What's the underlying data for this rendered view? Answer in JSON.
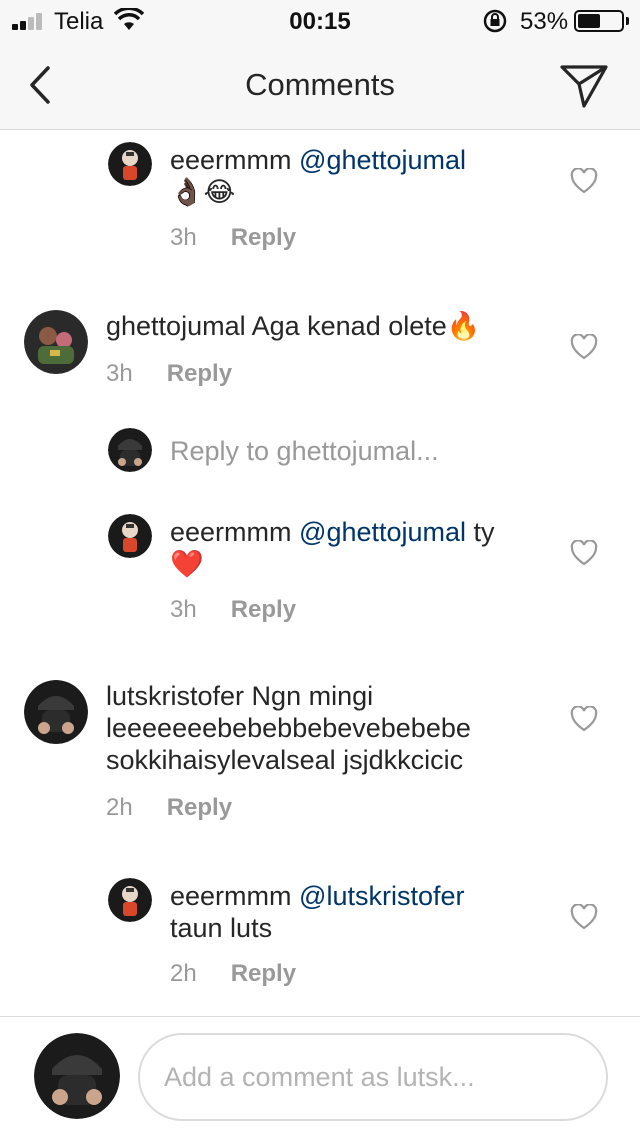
{
  "status_bar": {
    "carrier": "Telia",
    "time": "00:15",
    "battery_percent": "53%",
    "battery_level": 0.53
  },
  "nav": {
    "title": "Comments",
    "back_icon": "chevron-left-icon",
    "send_icon": "paper-plane-icon"
  },
  "comments": [
    {
      "username": "eeermmm",
      "mention": "@ghettojumal",
      "text": "",
      "emoji": "👌🏿😂",
      "time": "3h",
      "reply_label": "Reply"
    },
    {
      "username": "ghettojumal",
      "text": "Aga kenad olete",
      "emoji": "🔥",
      "time": "3h",
      "reply_label": "Reply"
    },
    {
      "username": "eeermmm",
      "mention": "@ghettojumal",
      "text": " ty",
      "emoji": "❤️",
      "time": "3h",
      "reply_label": "Reply"
    },
    {
      "username": "lutskristofer",
      "text": " Ngn mingi",
      "line2": "leeeeeeebebebbebevebebebe",
      "line3": "sokkihaisylevalseal jsjdkkcicic",
      "time": "2h",
      "reply_label": "Reply"
    },
    {
      "username": "eeermmm",
      "mention": "@lutskristofer",
      "line2": "taun luts",
      "time": "2h",
      "reply_label": "Reply"
    }
  ],
  "reply_prompt": "Reply to ghettojumal...",
  "composer": {
    "placeholder": "Add a comment as lutsk..."
  },
  "colors": {
    "mention": "#003569",
    "secondary_text": "#999999",
    "divider": "#dbdbdb"
  }
}
